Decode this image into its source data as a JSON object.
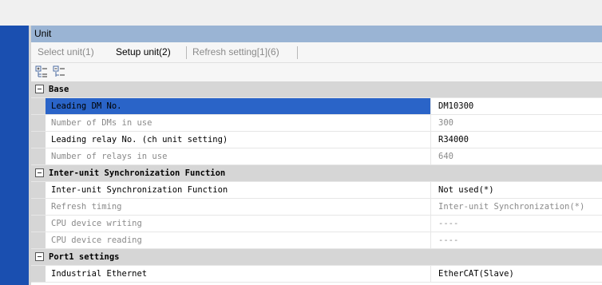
{
  "panel": {
    "title": "Unit"
  },
  "tabs": [
    {
      "label": "Select unit(1)"
    },
    {
      "label": "Setup unit(2)"
    },
    {
      "label": "Refresh setting[1](6)"
    }
  ],
  "toolbar": {
    "expand_icon": "expand-all-icon",
    "collapse_icon": "collapse-all-icon"
  },
  "colors": {
    "selection": "#2a64c8",
    "category_bg": "#d6d6d6",
    "title_bar": "#9ab4d4",
    "left_bar": "#1a4fb0"
  },
  "groups": [
    {
      "label": "Base",
      "rows": [
        {
          "name": "Leading DM No.",
          "value": "DM10300",
          "editable": true,
          "selected": true
        },
        {
          "name": "Number of DMs in use",
          "value": "300",
          "editable": false
        },
        {
          "name": "Leading relay No. (ch unit setting)",
          "value": "R34000",
          "editable": true
        },
        {
          "name": "Number of relays in use",
          "value": "640",
          "editable": false
        }
      ]
    },
    {
      "label": "Inter-unit Synchronization Function",
      "rows": [
        {
          "name": "Inter-unit Synchronization Function",
          "value": "Not used(*)",
          "editable": true
        },
        {
          "name": "Refresh timing",
          "value": "Inter-unit Synchronization(*)",
          "editable": false
        },
        {
          "name": "CPU device writing",
          "value": "----",
          "editable": false
        },
        {
          "name": "CPU device reading",
          "value": "----",
          "editable": false
        }
      ]
    },
    {
      "label": "Port1 settings",
      "rows": [
        {
          "name": "Industrial Ethernet",
          "value": "EtherCAT(Slave)",
          "editable": true
        }
      ]
    }
  ]
}
